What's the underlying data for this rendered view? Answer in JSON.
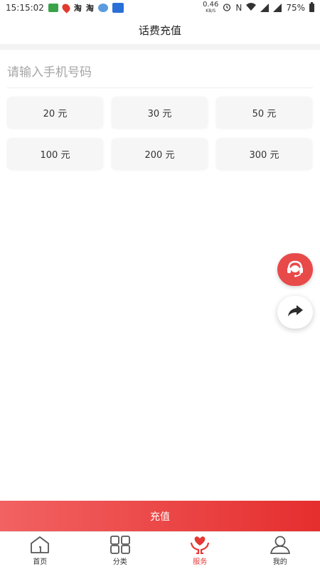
{
  "status_bar": {
    "time": "15:15:02",
    "app_icon_3": "淘",
    "app_icon_4": "淘",
    "net_speed": "0.46",
    "net_speed_unit": "KB/S",
    "nfc": "N",
    "battery": "75%"
  },
  "header": {
    "title": "话费充值"
  },
  "phone_input": {
    "placeholder": "请输入手机号码",
    "value": ""
  },
  "amounts": [
    {
      "label": "20 元"
    },
    {
      "label": "30 元"
    },
    {
      "label": "50 元"
    },
    {
      "label": "100 元"
    },
    {
      "label": "200 元"
    },
    {
      "label": "300 元"
    }
  ],
  "floating": {
    "service_icon": "headset-icon",
    "share_icon": "share-arrow-icon"
  },
  "recharge_button": {
    "label": "充值"
  },
  "bottom_nav": {
    "items": [
      {
        "label": "首页",
        "icon": "home-icon"
      },
      {
        "label": "分类",
        "icon": "grid-icon"
      },
      {
        "label": "服务",
        "icon": "heart-hands-icon",
        "active": true
      },
      {
        "label": "我的",
        "icon": "user-icon"
      }
    ]
  },
  "colors": {
    "accent": "#e53935",
    "button_gradient_start": "#f26262",
    "button_gradient_end": "#e52e2e",
    "amount_bg": "#f6f6f6"
  }
}
